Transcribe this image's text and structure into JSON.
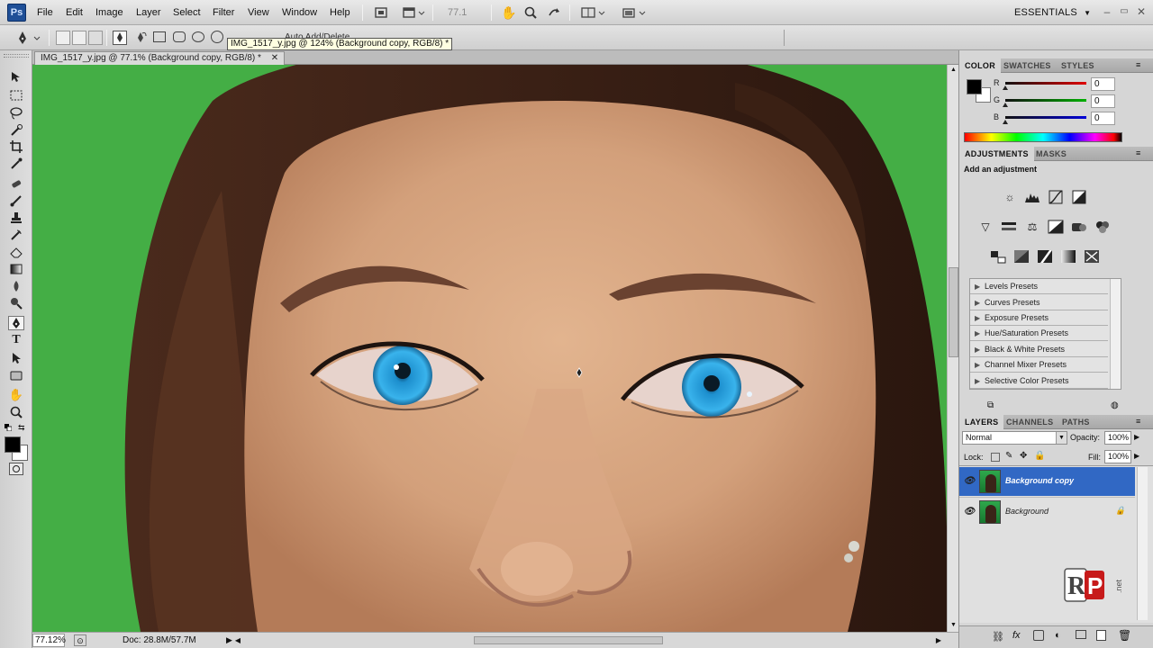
{
  "app": {
    "logo": "Ps",
    "workspace": "ESSENTIALS"
  },
  "menu": [
    "File",
    "Edit",
    "Image",
    "Layer",
    "Select",
    "Filter",
    "View",
    "Window",
    "Help"
  ],
  "appbar": {
    "zoom": "77.1"
  },
  "options": {
    "tooltip": "IMG_1517_y.jpg @ 124% (Background copy, RGB/8) *",
    "auto_add_delete": "Auto Add/Delete"
  },
  "document": {
    "tab_title": "IMG_1517_y.jpg @ 77.1% (Background copy, RGB/8) *"
  },
  "status": {
    "zoom": "77.12%",
    "doc_size": "Doc: 28.8M/57.7M"
  },
  "color_panel": {
    "tabs": [
      "COLOR",
      "SWATCHES",
      "STYLES"
    ],
    "channels": [
      {
        "label": "R",
        "value": "0",
        "color": "#d40000"
      },
      {
        "label": "G",
        "value": "0",
        "color": "#00a000"
      },
      {
        "label": "B",
        "value": "0",
        "color": "#0000c8"
      }
    ],
    "foreground": "#000000",
    "background": "#ffffff"
  },
  "adjustments_panel": {
    "tabs": [
      "ADJUSTMENTS",
      "MASKS"
    ],
    "heading": "Add an adjustment",
    "presets": [
      "Levels Presets",
      "Curves Presets",
      "Exposure Presets",
      "Hue/Saturation Presets",
      "Black & White Presets",
      "Channel Mixer Presets",
      "Selective Color Presets"
    ]
  },
  "layers_panel": {
    "tabs": [
      "LAYERS",
      "CHANNELS",
      "PATHS"
    ],
    "blend_mode": "Normal",
    "opacity_label": "Opacity:",
    "opacity": "100%",
    "lock_label": "Lock:",
    "fill_label": "Fill:",
    "fill": "100%",
    "layers": [
      {
        "name": "Background copy",
        "selected": true
      },
      {
        "name": "Background",
        "selected": false
      }
    ]
  },
  "watermark": {
    "text": "RP",
    "suffix": ".net"
  },
  "colors": {
    "accent_selected": "#3168c4",
    "green_screen": "#41b041"
  }
}
